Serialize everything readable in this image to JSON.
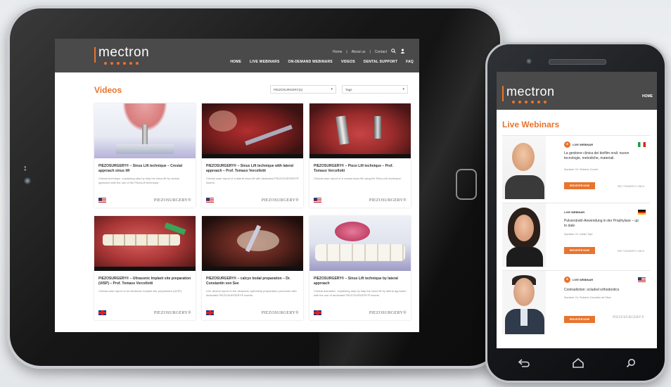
{
  "tablet": {
    "logo": "mectron",
    "util_links": [
      "Home",
      "|",
      "About us",
      "|",
      "Contact"
    ],
    "nav": [
      "HOME",
      "LIVE WEBINARS",
      "ON-DEMAND WEBINARS",
      "VIDEOS",
      "DENTAL SUPPORT",
      "FAQ"
    ],
    "page_title": "Videos",
    "filter1": "PIEZOSURGERY(a)",
    "filter2": "Tags",
    "cards": [
      {
        "title": "PIEZOSURGERY® – Sinus Lift technique – Crestal approach sinus lift",
        "desc": "Clinical technique, explaining step by step the sinus lift by crestal approach with the use of the PiezoLift technique.",
        "flag": "us",
        "brand": "PIEZOSURGERY®"
      },
      {
        "title": "PIEZOSURGERY® – Sinus Lift technique with lateral approach – Prof. Tomaso Vercellotti",
        "desc": "Clinical case report of a lateral sinus lift with dedicated PIEZOSURGERY® inserts.",
        "flag": "us",
        "brand": "PIEZOSURGERY®"
      },
      {
        "title": "PIEZOSURGERY® – Piezo Lift technique – Prof. Tomaso Vercellotti",
        "desc": "Clinical case report of a crestal sinus lift using the Piezo-Lift technique.",
        "flag": "us",
        "brand": "PIEZOSURGERY®"
      },
      {
        "title": "PIEZOSURGERY® – Ultrasonic Implant site preparation (UISP) – Prof. Tomaso Vercellotti",
        "desc": "Clinical case report of an ultrasonic implant site preparation (UISP).",
        "flag": "uk",
        "brand": "PIEZOSURGERY®"
      },
      {
        "title": "PIEZOSURGERY® – calcyx bodal preparation – Dr. Constantin von See",
        "desc": "Live clinical report of the ultrasonic cylindrical preparation procedure with dedicated PIEZOSURGERY® inserts.",
        "flag": "uk",
        "brand": "PIEZOSURGERY®"
      },
      {
        "title": "PIEZOSURGERY® – Sinus Lift technique by lateral approach",
        "desc": "Clinical animation, explaining step by step the sinus lift by lateral approach with the use of dedicated PIEZOSURGERY® inserts.",
        "flag": "uk",
        "brand": "PIEZOSURGERY®"
      }
    ]
  },
  "phone": {
    "logo": "mectron",
    "nav_home": "HOME",
    "page_title": "Live Webinars",
    "webinars": [
      {
        "label": "LIVE WEBINAR",
        "title": "La gestione clinica dei biofilm orali: nuove tecnologie, metodiche, materiali.",
        "speaker": "Speaker: Dr. Roberto Cocchi",
        "button": "REGISTER NOW",
        "right": "SEE   TRAINER'S LINKS",
        "flag": "it"
      },
      {
        "label": "LIVE WEBINAR",
        "title": "Pulverstrahl-Anwendung in der Prophylaxe – up to date",
        "speaker": "Speaker: Dr. Dieter Topf",
        "button": "REGISTER NOW",
        "right": "SEE   TRAINER'S LINKS",
        "flag": "de"
      },
      {
        "label": "LIVE WEBINAR",
        "title": "Contradiction: ocluded orthodontics",
        "speaker": "Speaker: Dr. Roberto Carvalho da Silva",
        "button": "REGISTER NOW",
        "right": "PIEZOSURGERY®",
        "flag": "us"
      }
    ]
  },
  "icons": {
    "search": "search-icon",
    "user": "user-icon",
    "back": "back-icon",
    "home": "home-icon",
    "search_nav": "search-icon"
  }
}
